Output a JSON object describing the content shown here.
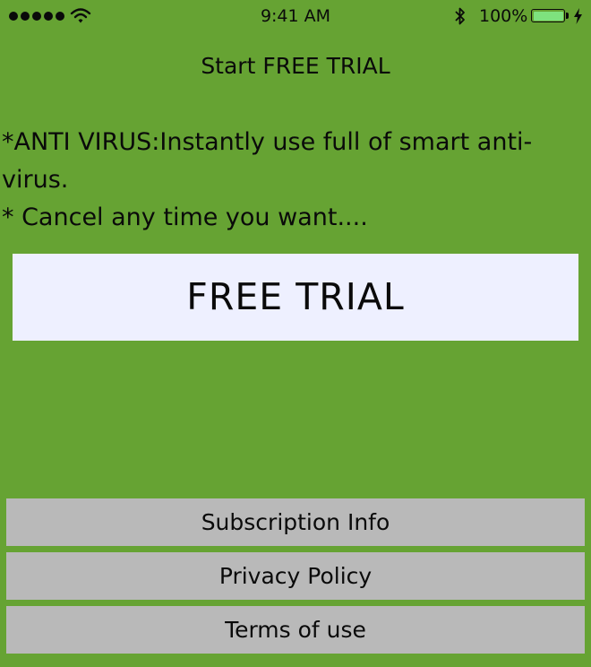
{
  "status_bar": {
    "time": "9:41 AM",
    "battery_percent": "100%",
    "icons": [
      "signal-dots-icon",
      "wifi-icon",
      "bluetooth-icon",
      "battery-icon",
      "charging-bolt-icon"
    ],
    "battery_level": 1.0,
    "battery_color": "#7ee27e"
  },
  "header": {
    "title": "Start FREE TRIAL"
  },
  "features": {
    "line1": "*ANTI VIRUS:Instantly use full of smart anti-virus.",
    "line2": "* Cancel any time you want...."
  },
  "cta": {
    "label": "FREE TRIAL"
  },
  "links": {
    "subscription_info": "Subscription Info",
    "privacy_policy": "Privacy Policy",
    "terms_of_use": "Terms of use"
  },
  "colors": {
    "background": "#66a333",
    "cta_background": "#eef0ff",
    "link_background": "#b9b9b9"
  }
}
